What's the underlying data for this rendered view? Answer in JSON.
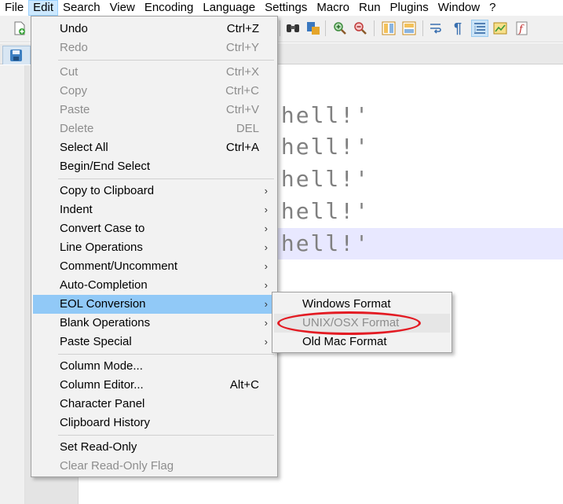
{
  "menubar": {
    "items": [
      "File",
      "Edit",
      "Search",
      "View",
      "Encoding",
      "Language",
      "Settings",
      "Macro",
      "Run",
      "Plugins",
      "Window",
      "?"
    ]
  },
  "toolbar": {
    "icons": [
      "new-file-icon",
      "find-icon",
      "replace-icon",
      "zoom-in-icon",
      "zoom-out-icon",
      "sync-vertical-icon",
      "sync-horizontal-icon",
      "word-wrap-icon",
      "show-all-chars-icon",
      "indent-guide-icon",
      "doc-map-icon",
      "function-list-icon"
    ]
  },
  "editor": {
    "lines": [
      "shell!'",
      "shell!'",
      "shell!'",
      "shell!'",
      "shell!'"
    ],
    "current_line_index": 4
  },
  "edit_menu": {
    "undo": {
      "label": "Undo",
      "shortcut": "Ctrl+Z"
    },
    "redo": {
      "label": "Redo",
      "shortcut": "Ctrl+Y"
    },
    "cut": {
      "label": "Cut",
      "shortcut": "Ctrl+X"
    },
    "copy": {
      "label": "Copy",
      "shortcut": "Ctrl+C"
    },
    "paste": {
      "label": "Paste",
      "shortcut": "Ctrl+V"
    },
    "delete": {
      "label": "Delete",
      "shortcut": "DEL"
    },
    "select_all": {
      "label": "Select All",
      "shortcut": "Ctrl+A"
    },
    "begin_end_select": {
      "label": "Begin/End Select"
    },
    "copy_to_clipboard": {
      "label": "Copy to Clipboard"
    },
    "indent": {
      "label": "Indent"
    },
    "convert_case": {
      "label": "Convert Case to"
    },
    "line_operations": {
      "label": "Line Operations"
    },
    "comment": {
      "label": "Comment/Uncomment"
    },
    "auto_completion": {
      "label": "Auto-Completion"
    },
    "eol_conversion": {
      "label": "EOL Conversion"
    },
    "blank_operations": {
      "label": "Blank Operations"
    },
    "paste_special": {
      "label": "Paste Special"
    },
    "column_mode": {
      "label": "Column Mode..."
    },
    "column_editor": {
      "label": "Column Editor...",
      "shortcut": "Alt+C"
    },
    "character_panel": {
      "label": "Character Panel"
    },
    "clipboard_history": {
      "label": "Clipboard History"
    },
    "set_read_only": {
      "label": "Set Read-Only"
    },
    "clear_read_only": {
      "label": "Clear Read-Only Flag"
    },
    "submenu_arrow": "›"
  },
  "eol_submenu": {
    "windows": "Windows Format",
    "unix": "UNIX/OSX Format",
    "mac": "Old Mac Format"
  },
  "colors": {
    "highlight": "#91c9f7",
    "annotation": "#e31b23",
    "current_line": "#e8e8ff"
  }
}
